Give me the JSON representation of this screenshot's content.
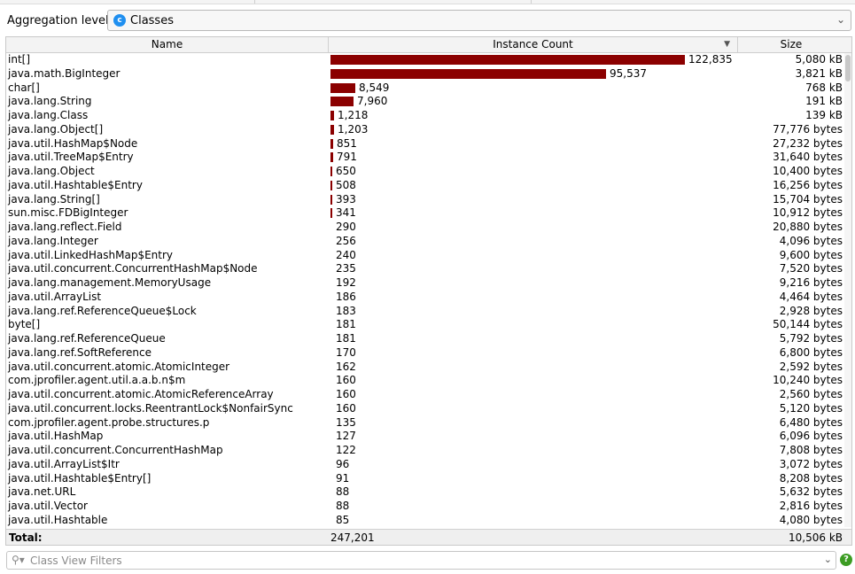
{
  "aggregation": {
    "label": "Aggregation level:",
    "selected": "Classes",
    "icon": "class-c-icon"
  },
  "table": {
    "columns": [
      "Name",
      "Instance Count",
      "Size"
    ],
    "sort_column": "Instance Count",
    "sort_direction": "descending",
    "bar_color": "#8b0000",
    "rows": [
      {
        "name": "int[]",
        "count": "122,835",
        "size": "5,080 kB",
        "value": 122835
      },
      {
        "name": "java.math.BigInteger",
        "count": "95,537",
        "size": "3,821 kB",
        "value": 95537
      },
      {
        "name": "char[]",
        "count": "8,549",
        "size": "768 kB",
        "value": 8549
      },
      {
        "name": "java.lang.String",
        "count": "7,960",
        "size": "191 kB",
        "value": 7960
      },
      {
        "name": "java.lang.Class",
        "count": "1,218",
        "size": "139 kB",
        "value": 1218
      },
      {
        "name": "java.lang.Object[]",
        "count": "1,203",
        "size": "77,776 bytes",
        "value": 1203
      },
      {
        "name": "java.util.HashMap$Node",
        "count": "851",
        "size": "27,232 bytes",
        "value": 851
      },
      {
        "name": "java.util.TreeMap$Entry",
        "count": "791",
        "size": "31,640 bytes",
        "value": 791
      },
      {
        "name": "java.lang.Object",
        "count": "650",
        "size": "10,400 bytes",
        "value": 650
      },
      {
        "name": "java.util.Hashtable$Entry",
        "count": "508",
        "size": "16,256 bytes",
        "value": 508
      },
      {
        "name": "java.lang.String[]",
        "count": "393",
        "size": "15,704 bytes",
        "value": 393
      },
      {
        "name": "sun.misc.FDBigInteger",
        "count": "341",
        "size": "10,912 bytes",
        "value": 341
      },
      {
        "name": "java.lang.reflect.Field",
        "count": "290",
        "size": "20,880 bytes",
        "value": 290
      },
      {
        "name": "java.lang.Integer",
        "count": "256",
        "size": "4,096 bytes",
        "value": 256
      },
      {
        "name": "java.util.LinkedHashMap$Entry",
        "count": "240",
        "size": "9,600 bytes",
        "value": 240
      },
      {
        "name": "java.util.concurrent.ConcurrentHashMap$Node",
        "count": "235",
        "size": "7,520 bytes",
        "value": 235
      },
      {
        "name": "java.lang.management.MemoryUsage",
        "count": "192",
        "size": "9,216 bytes",
        "value": 192
      },
      {
        "name": "java.util.ArrayList",
        "count": "186",
        "size": "4,464 bytes",
        "value": 186
      },
      {
        "name": "java.lang.ref.ReferenceQueue$Lock",
        "count": "183",
        "size": "2,928 bytes",
        "value": 183
      },
      {
        "name": "byte[]",
        "count": "181",
        "size": "50,144 bytes",
        "value": 181
      },
      {
        "name": "java.lang.ref.ReferenceQueue",
        "count": "181",
        "size": "5,792 bytes",
        "value": 181
      },
      {
        "name": "java.lang.ref.SoftReference",
        "count": "170",
        "size": "6,800 bytes",
        "value": 170
      },
      {
        "name": "java.util.concurrent.atomic.AtomicInteger",
        "count": "162",
        "size": "2,592 bytes",
        "value": 162
      },
      {
        "name": "com.jprofiler.agent.util.a.a.b.n$m",
        "count": "160",
        "size": "10,240 bytes",
        "value": 160
      },
      {
        "name": "java.util.concurrent.atomic.AtomicReferenceArray",
        "count": "160",
        "size": "2,560 bytes",
        "value": 160
      },
      {
        "name": "java.util.concurrent.locks.ReentrantLock$NonfairSync",
        "count": "160",
        "size": "5,120 bytes",
        "value": 160
      },
      {
        "name": "com.jprofiler.agent.probe.structures.p",
        "count": "135",
        "size": "6,480 bytes",
        "value": 135
      },
      {
        "name": "java.util.HashMap",
        "count": "127",
        "size": "6,096 bytes",
        "value": 127
      },
      {
        "name": "java.util.concurrent.ConcurrentHashMap",
        "count": "122",
        "size": "7,808 bytes",
        "value": 122
      },
      {
        "name": "java.util.ArrayList$Itr",
        "count": "96",
        "size": "3,072 bytes",
        "value": 96
      },
      {
        "name": "java.util.Hashtable$Entry[]",
        "count": "91",
        "size": "8,208 bytes",
        "value": 91
      },
      {
        "name": "java.net.URL",
        "count": "88",
        "size": "5,632 bytes",
        "value": 88
      },
      {
        "name": "java.util.Vector",
        "count": "88",
        "size": "2,816 bytes",
        "value": 88
      },
      {
        "name": "java.util.Hashtable",
        "count": "85",
        "size": "4,080 bytes",
        "value": 85
      }
    ],
    "total": {
      "label": "Total:",
      "count": "247,201",
      "size": "10,506 kB"
    }
  },
  "filter": {
    "placeholder": "Class View Filters",
    "icon": "search-icon"
  },
  "help_icon": "help-icon"
}
